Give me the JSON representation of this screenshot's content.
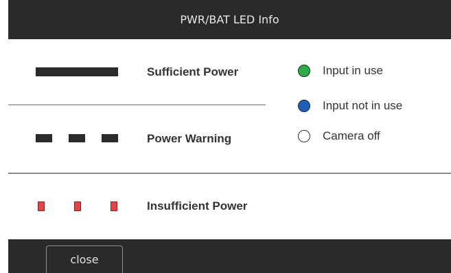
{
  "dialog": {
    "title": "PWR/BAT LED Info"
  },
  "power_rows": [
    {
      "label": "Sufficient Power",
      "led": "solid-bar",
      "color": "#2b2b2b"
    },
    {
      "label": "Power Warning",
      "led": "dashed-blocks",
      "color": "#2b2b2b"
    },
    {
      "label": "Insufficient Power",
      "led": "red-blinking-dots",
      "color": "#e24545"
    }
  ],
  "legend": [
    {
      "label": "Input in use",
      "icon": "green-dot-icon",
      "color": "#2eaa4a"
    },
    {
      "label": "Input not in use",
      "icon": "blue-dot-icon",
      "color": "#1f5fb5"
    },
    {
      "label": "Camera off",
      "icon": "empty-circle-icon",
      "color": "#ffffff"
    }
  ],
  "footer": {
    "close_label": "close"
  },
  "colors": {
    "titlebar_bg": "#2a2a2a",
    "content_bg": "#ffffff",
    "text": "#333333"
  }
}
